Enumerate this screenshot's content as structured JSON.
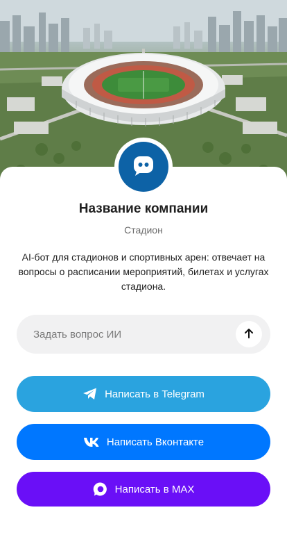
{
  "company": {
    "name": "Название компании",
    "category": "Стадион",
    "description": "AI-бот для стадионов и спортивных арен: отвечает на вопросы о расписании мероприятий, билетах и услугах стадиона."
  },
  "ask": {
    "placeholder": "Задать вопрос ИИ"
  },
  "actions": {
    "telegram_label": "Написать в Telegram",
    "vk_label": "Написать Вконтакте",
    "max_label": "Написать в MAX"
  },
  "colors": {
    "avatar_bg": "#0d62a6",
    "telegram": "#2aa3df",
    "vk": "#0077ff",
    "max": "#6a0ff7"
  },
  "icons": {
    "avatar": "chat-bot-icon",
    "send": "arrow-up-icon",
    "telegram": "telegram-icon",
    "vk": "vk-icon",
    "max": "max-messenger-icon"
  }
}
